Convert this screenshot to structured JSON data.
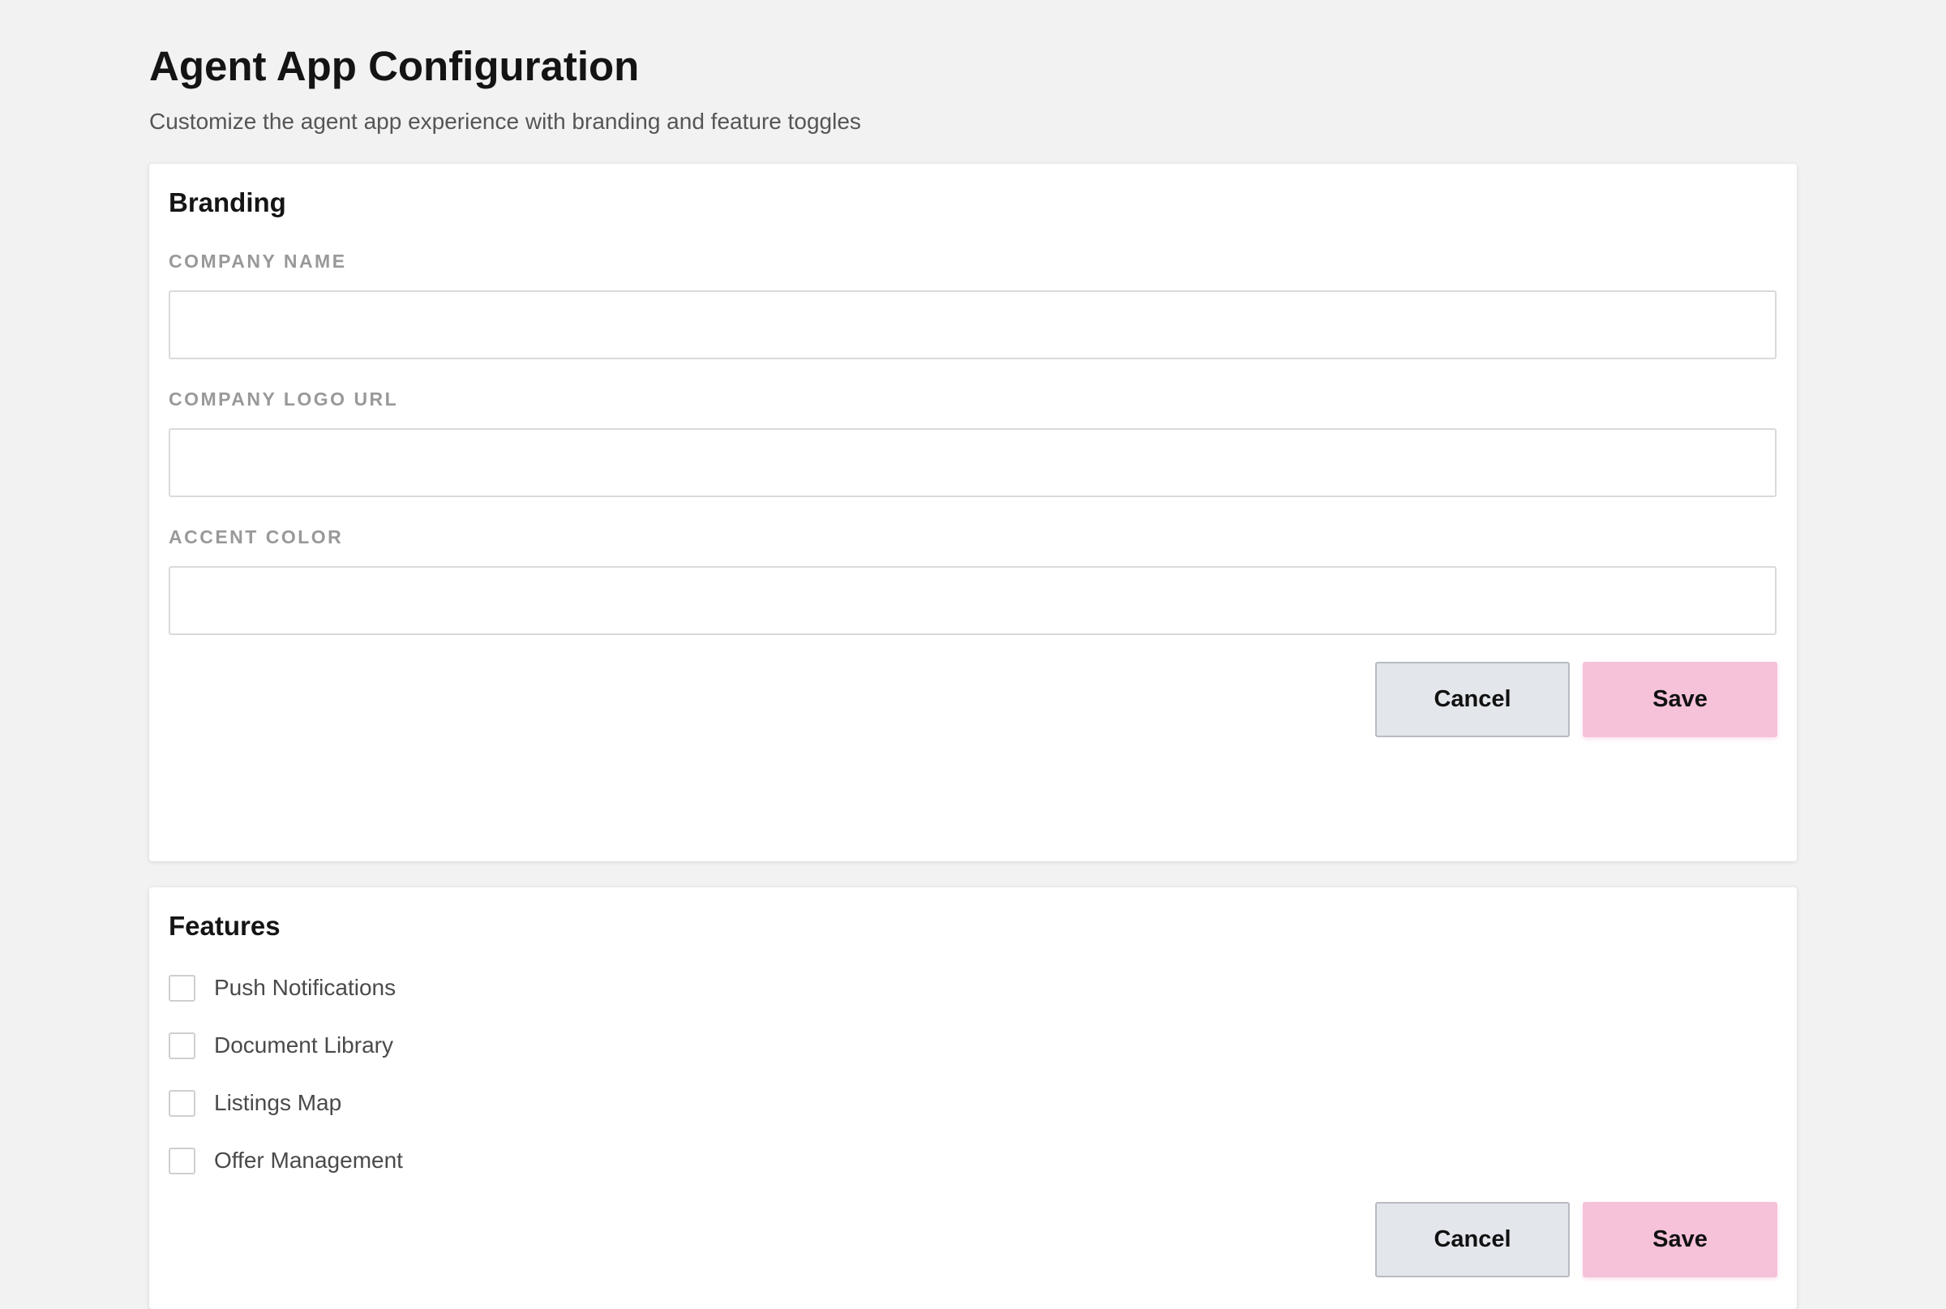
{
  "page": {
    "title": "Agent App Configuration",
    "subtitle": "Customize the agent app experience with branding and feature toggles"
  },
  "branding": {
    "title": "Branding",
    "fields": [
      {
        "label": "COMPANY NAME",
        "value": ""
      },
      {
        "label": "COMPANY LOGO URL",
        "value": ""
      },
      {
        "label": "ACCENT COLOR",
        "value": ""
      }
    ],
    "cancel_label": "Cancel",
    "save_label": "Save"
  },
  "features": {
    "title": "Features",
    "items": [
      {
        "label": "Push Notifications",
        "checked": false
      },
      {
        "label": "Document Library",
        "checked": false
      },
      {
        "label": "Listings Map",
        "checked": false
      },
      {
        "label": "Offer Management",
        "checked": false
      }
    ],
    "cancel_label": "Cancel",
    "save_label": "Save"
  },
  "colors": {
    "background": "#f2f2f2",
    "save_button": "#f5c2da",
    "cancel_button": "#e3e6eb"
  }
}
